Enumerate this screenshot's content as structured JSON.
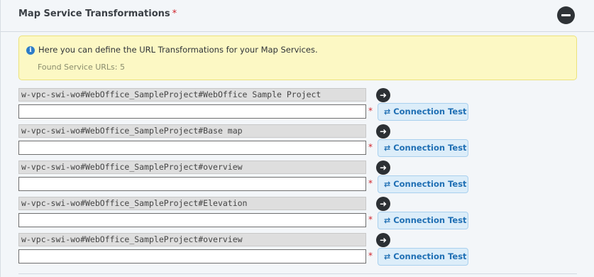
{
  "section": {
    "title": "Map Service Transformations",
    "required_marker": "*"
  },
  "info": {
    "icon": "info-icon",
    "message": "Here you can define the URL Transformations for your Map Services.",
    "found_label": "Found Service URLs: 5"
  },
  "rows": [
    {
      "source": "w-vpc-swi-wo#WebOffice_SampleProject#WebOffice Sample Project",
      "target": "",
      "required": "*",
      "button": "Connection Test"
    },
    {
      "source": "w-vpc-swi-wo#WebOffice_SampleProject#Base map",
      "target": "",
      "required": "*",
      "button": "Connection Test"
    },
    {
      "source": "w-vpc-swi-wo#WebOffice_SampleProject#overview",
      "target": "",
      "required": "*",
      "button": "Connection Test"
    },
    {
      "source": "w-vpc-swi-wo#WebOffice_SampleProject#Elevation",
      "target": "",
      "required": "*",
      "button": "Connection Test"
    },
    {
      "source": "w-vpc-swi-wo#WebOffice_SampleProject#overview",
      "target": "",
      "required": "*",
      "button": "Connection Test"
    }
  ],
  "icons": {
    "collapse": "minus-circle-icon",
    "copy": "arrow-right-icon",
    "connection": "exchange-icon"
  }
}
